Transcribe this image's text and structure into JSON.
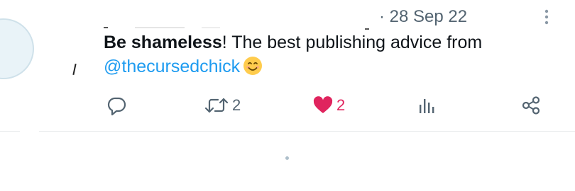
{
  "tweet": {
    "timestamp": "· 28 Sep 22",
    "text_bold": "Be shameless",
    "text_rest": "! The best publishing advice from",
    "mention": "@thecursedchick",
    "emoji": "smiling-face-with-smiling-eyes"
  },
  "actions": {
    "reply": {
      "icon": "reply-icon",
      "count": ""
    },
    "retweet": {
      "icon": "retweet-icon",
      "count": "2"
    },
    "like": {
      "icon": "heart-icon",
      "count": "2",
      "color": "#e0245e"
    },
    "views": {
      "icon": "views-icon",
      "count": ""
    },
    "share": {
      "icon": "share-icon",
      "count": ""
    }
  },
  "colors": {
    "text": "#0f1419",
    "secondary": "#536471",
    "link": "#1d9bf0",
    "like": "#e0245e",
    "divider": "#e5e8ea"
  }
}
